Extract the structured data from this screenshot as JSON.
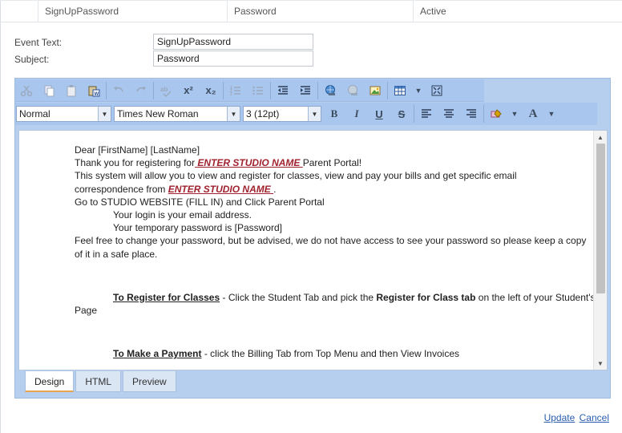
{
  "grid_row": {
    "event_text": "SignUpPassword",
    "subject": "Password",
    "status": "Active"
  },
  "form": {
    "event_text_label": "Event Text:",
    "event_text_value": "SignUpPassword",
    "subject_label": "Subject:",
    "subject_value": "Password"
  },
  "toolbar": {
    "format_value": "Normal",
    "font_value": "Times New Roman",
    "size_value": "3 (12pt)",
    "superscript": "x²",
    "subscript": "x₂",
    "bold": "B",
    "italic": "I",
    "underline": "U",
    "strike": "S",
    "fore_color": "A"
  },
  "content": {
    "l1": "Dear [FirstName]  [LastName]",
    "l2a": "Thank you for registering for",
    "l2b": " ENTER STUDIO NAME ",
    "l2c": "Parent Portal!",
    "l3": "This system will allow you to view and register for classes, view and pay your bills and get specific email",
    "l4a": "correspondence from ",
    "l4b": " ENTER STUDIO NAME  ",
    "l4c": ".",
    "l5": "Go to STUDIO WEBSITE (FILL IN) and Click Parent Portal",
    "l6": "Your login is your email address.",
    "l7": "Your  temporary password is [Password]",
    "l8": "Feel free to change your password, but be advised, we do not have access to see your password so please keep a copy of it in a safe place.",
    "reg_title": "To Register for Classes",
    "reg_a": " - Click the Student Tab and pick the ",
    "reg_b": "Register for Class tab",
    "reg_c": " on the left of your Student's Page",
    "pay_title": "To Make a Payment",
    "pay_a": " - click the Billing Tab  from Top Menu  and then View Invoices"
  },
  "tabs": [
    "Design",
    "HTML",
    "Preview"
  ],
  "footer": {
    "update": "Update",
    "cancel": "Cancel"
  }
}
